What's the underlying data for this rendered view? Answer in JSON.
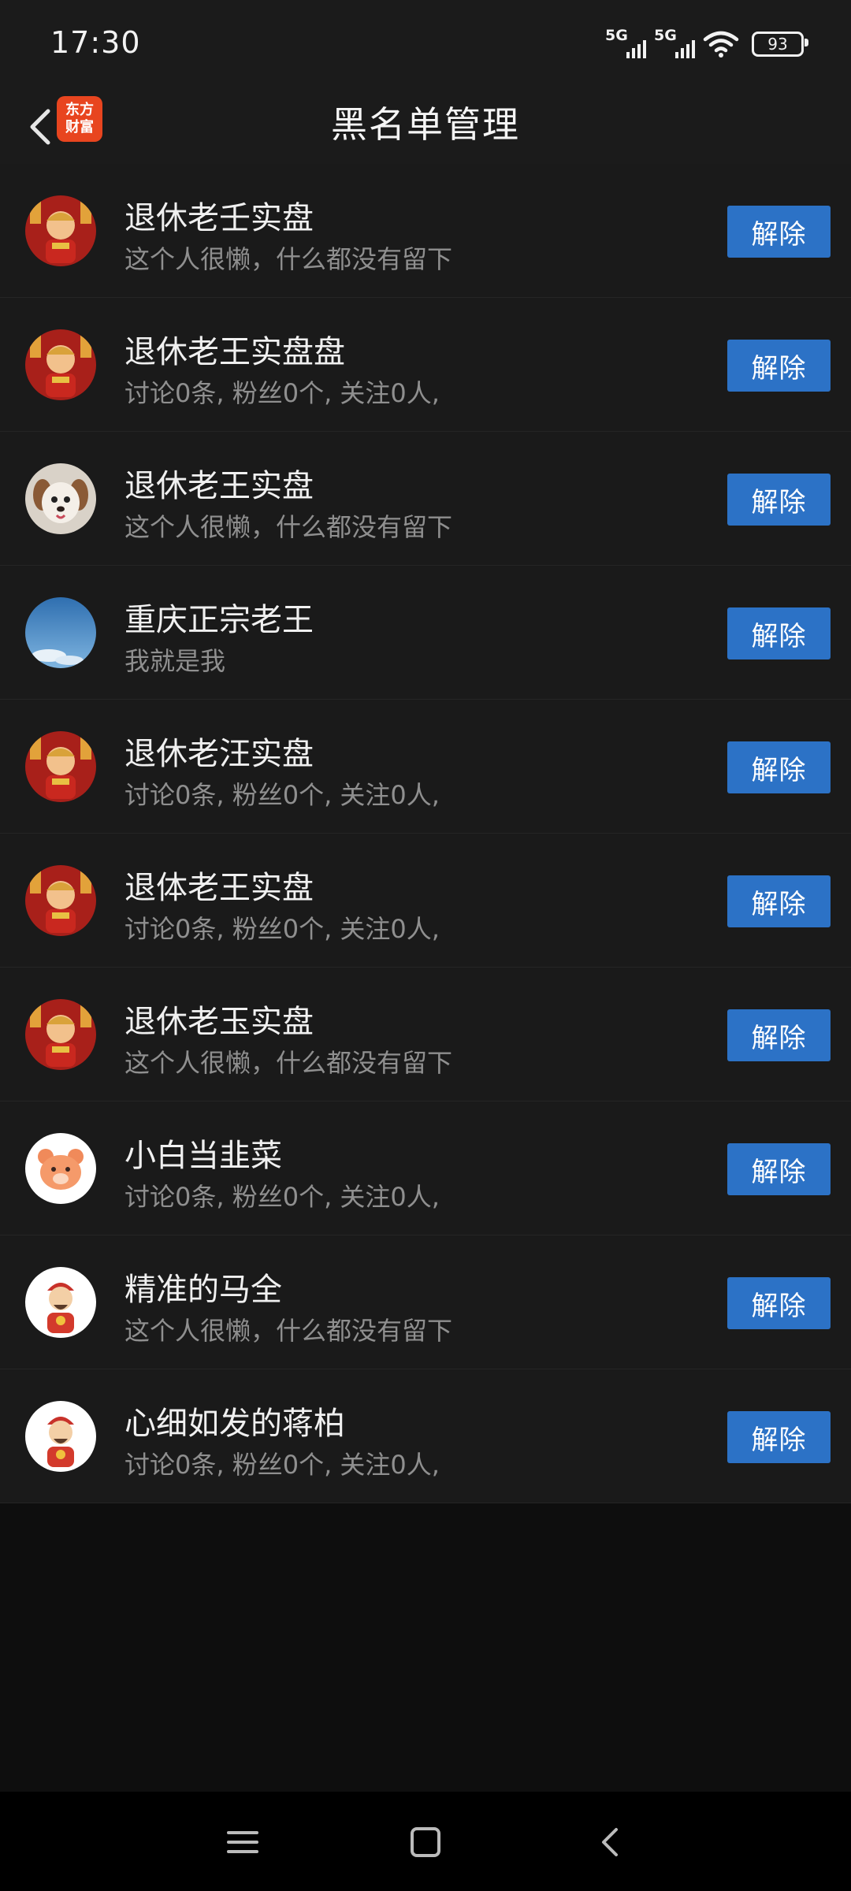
{
  "status_bar": {
    "time": "17:30",
    "signal_1": "5G",
    "signal_2": "5G",
    "battery": "93"
  },
  "header": {
    "title": "黑名单管理",
    "logo_line1": "东方",
    "logo_line2": "财富"
  },
  "button_label": "解除",
  "users": [
    {
      "name": "退休老壬实盘",
      "desc": "这个人很懒，什么都没有留下",
      "avatar": "caishen-red-icon"
    },
    {
      "name": "退休老王实盘盘",
      "desc": "讨论0条, 粉丝0个, 关注0人,",
      "avatar": "caishen-red-icon"
    },
    {
      "name": "退休老王实盘",
      "desc": "这个人很懒，什么都没有留下",
      "avatar": "puppy-icon"
    },
    {
      "name": "重庆正宗老王",
      "desc": "我就是我",
      "avatar": "sky-icon"
    },
    {
      "name": "退休老汪实盘",
      "desc": "讨论0条, 粉丝0个, 关注0人,",
      "avatar": "caishen-red-icon"
    },
    {
      "name": "退体老王实盘",
      "desc": "讨论0条, 粉丝0个, 关注0人,",
      "avatar": "caishen-red-icon"
    },
    {
      "name": "退休老玉实盘",
      "desc": "这个人很懒，什么都没有留下",
      "avatar": "caishen-red-icon"
    },
    {
      "name": "小白当韭菜",
      "desc": "讨论0条, 粉丝0个, 关注0人,",
      "avatar": "bear-icon"
    },
    {
      "name": "精准的马全",
      "desc": "这个人很懒，什么都没有留下",
      "avatar": "caishen-white-icon"
    },
    {
      "name": "心细如发的蒋柏",
      "desc": "讨论0条, 粉丝0个, 关注0人,",
      "avatar": "caishen-white-icon"
    }
  ],
  "colors": {
    "button": "#2c72c6",
    "background": "#1a1a1a",
    "logo": "#e8451f"
  }
}
